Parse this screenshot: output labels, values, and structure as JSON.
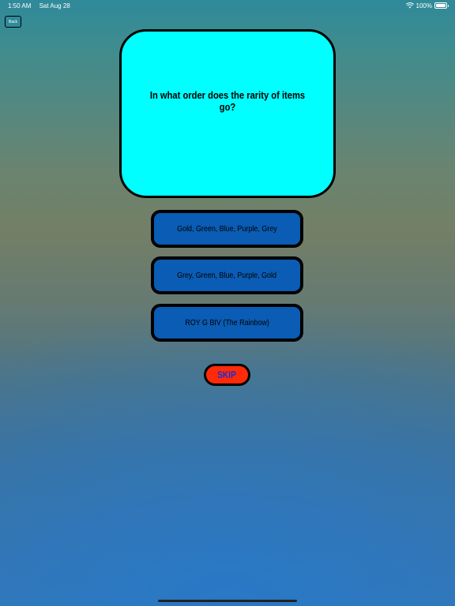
{
  "status_bar": {
    "time": "1:50 AM",
    "date": "Sat Aug 28",
    "battery": "100%",
    "wifi_icon": "wifi-icon",
    "battery_icon": "battery-icon"
  },
  "nav": {
    "back_label": "Back"
  },
  "question": {
    "text": "In what order does the rarity of items go?"
  },
  "answers": [
    {
      "label": "Gold, Green, Blue, Purple, Grey"
    },
    {
      "label": "Grey, Green, Blue, Purple, Gold"
    },
    {
      "label": "ROY G BIV (The Rainbow)"
    }
  ],
  "skip": {
    "label": "SKIP"
  },
  "colors": {
    "card": "#00ffff",
    "answer": "#0a5cb4",
    "skip": "#ff2a08",
    "skip_text": "#1a2fd0"
  }
}
